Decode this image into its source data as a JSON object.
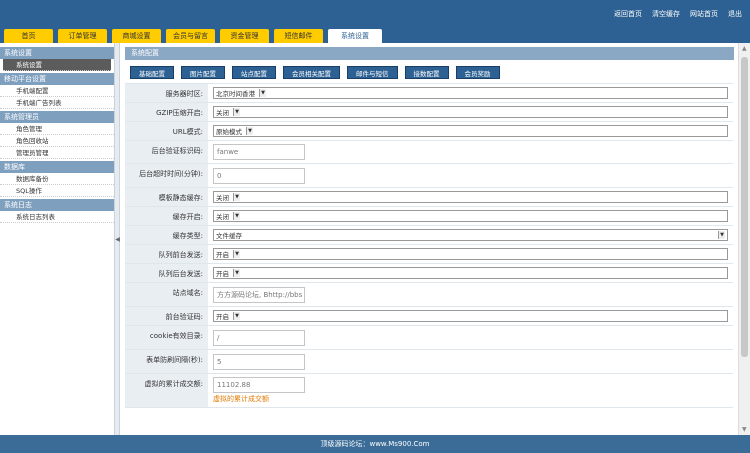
{
  "header": {
    "top_links": [
      "返回首页",
      "清空缓存",
      "网站首页",
      "退出"
    ],
    "nav_tabs": [
      {
        "label": "首页",
        "active": false
      },
      {
        "label": "订单管理",
        "active": false
      },
      {
        "label": "商城设置",
        "active": false
      },
      {
        "label": "会员与留言",
        "active": false
      },
      {
        "label": "资金管理",
        "active": false
      },
      {
        "label": "短信邮件",
        "active": false
      },
      {
        "label": "系统设置",
        "active": true
      }
    ]
  },
  "sidebar": {
    "groups": [
      {
        "title": "系统设置",
        "items": [
          {
            "label": "系统设置",
            "active": true
          }
        ]
      },
      {
        "title": "移动平台设置",
        "items": [
          {
            "label": "手机端配置",
            "active": false
          },
          {
            "label": "手机端广告列表",
            "active": false
          }
        ]
      },
      {
        "title": "系统管理员",
        "items": [
          {
            "label": "角色管理",
            "active": false
          },
          {
            "label": "角色回收站",
            "active": false
          },
          {
            "label": "管理员管理",
            "active": false
          }
        ]
      },
      {
        "title": "数据库",
        "items": [
          {
            "label": "数据库备份",
            "active": false
          },
          {
            "label": "SQL操作",
            "active": false
          }
        ]
      },
      {
        "title": "系统日志",
        "items": [
          {
            "label": "系统日志列表",
            "active": false
          }
        ]
      }
    ]
  },
  "main": {
    "panel_title": "系统配置",
    "sub_tabs": [
      "基础配置",
      "图片配置",
      "站点配置",
      "会员相关配置",
      "邮件与短信",
      "接数配置",
      "会员奖励"
    ],
    "rows": [
      {
        "label": "服务器时区:",
        "type": "select",
        "value": "北京时间香港"
      },
      {
        "label": "GZIP压缩开启:",
        "type": "select",
        "value": "关闭"
      },
      {
        "label": "URL模式:",
        "type": "select",
        "value": "原始模式"
      },
      {
        "label": "后台验证标识码:",
        "type": "input",
        "value": "fanwe"
      },
      {
        "label": "后台超时时间(分钟):",
        "type": "input",
        "value": "0",
        "tall": true
      },
      {
        "label": "模板静态缓存:",
        "type": "select",
        "value": "关闭"
      },
      {
        "label": "缓存开启:",
        "type": "select",
        "value": "关闭"
      },
      {
        "label": "缓存类型:",
        "type": "select",
        "value": "文件缓存",
        "wide": true
      },
      {
        "label": "队列前台发送:",
        "type": "select",
        "value": "开启"
      },
      {
        "label": "队列后台发送:",
        "type": "select",
        "value": "开启"
      },
      {
        "label": "站点域名:",
        "type": "input",
        "value": "方方源码论坛, Bhttp://bbs",
        "tall": true
      },
      {
        "label": "前台验证码:",
        "type": "select",
        "value": "开启"
      },
      {
        "label": "cookie有效目录:",
        "type": "input",
        "value": "/",
        "tall": true
      },
      {
        "label": "表单防刷间隔(秒):",
        "type": "input",
        "value": "5",
        "tall": true
      },
      {
        "label": "虚拟的累计成交额:",
        "type": "input",
        "value": "11102.88",
        "note": "虚拟的累计成交额",
        "tall": true
      }
    ]
  },
  "footer": {
    "text": "顶级源码论坛：www.Ms900.Com"
  }
}
